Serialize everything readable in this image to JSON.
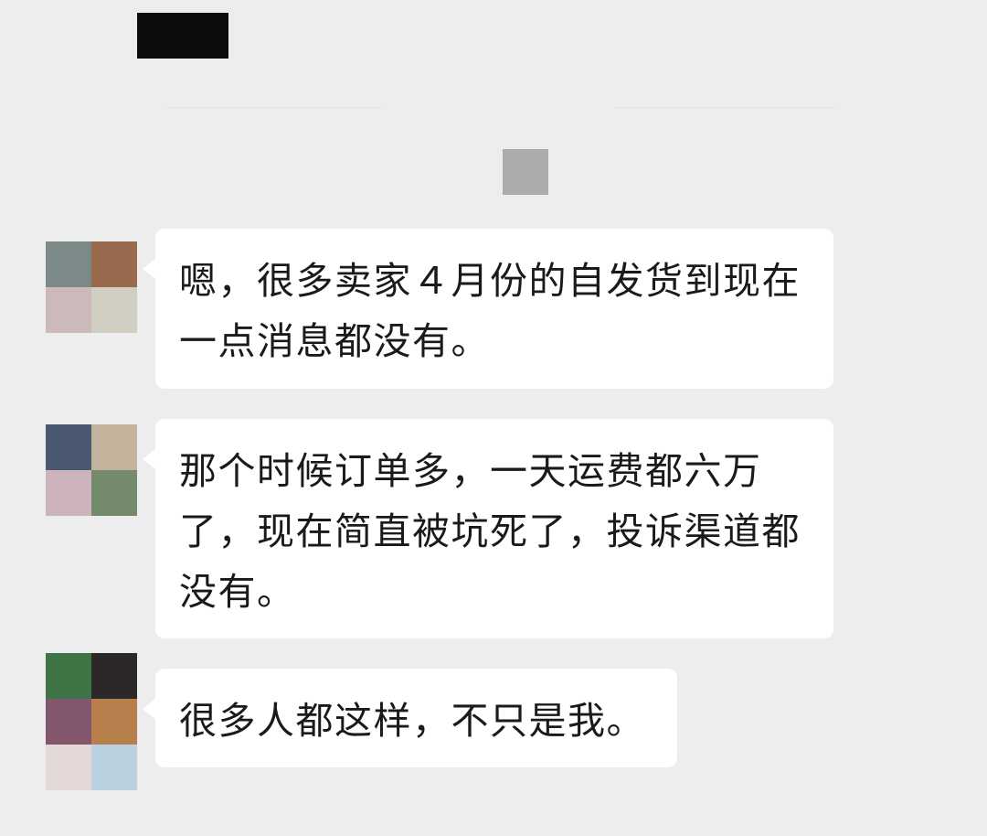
{
  "colors": {
    "background": "#ededed",
    "bubble": "#ffffff",
    "text": "#1a1a1a",
    "redaction": "#0c0c0c",
    "center_mosaic": "#acacac"
  },
  "messages": [
    {
      "text": "嗯，很多卖家４月份的自发货到现在一点消息都没有。",
      "avatar_colors": [
        "#7b8a88",
        "#9a6a4f",
        "#ccb9b9",
        "#d0cec0"
      ]
    },
    {
      "text": "那个时候订单多，一天运费都六万了，现在简直被坑死了，投诉渠道都没有。",
      "avatar_colors": [
        "#4b5871",
        "#c3b39c",
        "#cdb3bc",
        "#738a6c"
      ]
    },
    {
      "text": "很多人都这样，不只是我。",
      "avatar_colors": [
        "#3f7447",
        "#2c2828",
        "#82576d",
        "#b67f4b",
        "#e4d9d7",
        "#bcd1df"
      ]
    }
  ]
}
